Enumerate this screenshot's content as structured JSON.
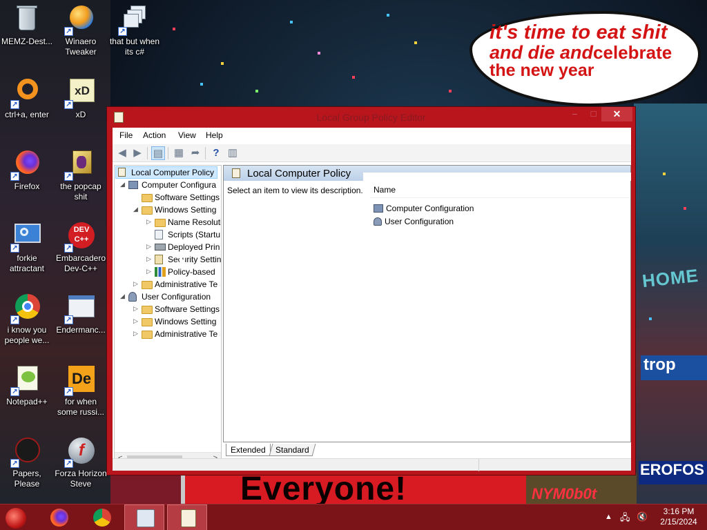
{
  "wallpaper": {
    "bubble_line1": "it's time to eat shit",
    "bubble_line2a": "and die and",
    "bubble_line2b": "celebrate",
    "bubble_line3": "the new year",
    "banner_text": "Everyone!",
    "banner_small": "NYM0b0t",
    "sign_home": "HOME",
    "sign_trop": "trop",
    "sign_erof": "EROFOS",
    "accent_red": "#d81a22"
  },
  "desktop_icons": [
    {
      "label": "MEMZ-Dest...",
      "icon": "recycle-bin-icon"
    },
    {
      "label": "Winaero Tweaker",
      "icon": "winaero-icon"
    },
    {
      "label": "that but when its c#",
      "icon": "windows-stack-icon"
    },
    {
      "label": "ctrl+a, enter",
      "icon": "orange-ring-icon"
    },
    {
      "label": "xD",
      "icon": "xd-icon"
    },
    {
      "label": "Firefox",
      "icon": "firefox-icon"
    },
    {
      "label": "the popcap shit",
      "icon": "popcap-icon"
    },
    {
      "label": "forkie attractant",
      "icon": "control-panel-icon"
    },
    {
      "label": "Embarcadero Dev-C++",
      "icon": "devcpp-icon"
    },
    {
      "label": "i know you people we...",
      "icon": "chrome-icon"
    },
    {
      "label": "Endermanc...",
      "icon": "window-icon"
    },
    {
      "label": "Notepad++",
      "icon": "notepadpp-icon"
    },
    {
      "label": "for when some russi...",
      "icon": "de-icon"
    },
    {
      "label": "Papers, Please",
      "icon": "papers-please-icon"
    },
    {
      "label": "Forza Horizon Steve",
      "icon": "flash-icon"
    }
  ],
  "window": {
    "title": "Local Group Policy Editor",
    "min": "–",
    "max": "□",
    "close": "✕",
    "menu": [
      "File",
      "Action",
      "View",
      "Help"
    ],
    "tree": [
      {
        "label": "Local Computer Policy",
        "expander": "",
        "icon": "policy-icon"
      },
      {
        "label": "Computer Configura",
        "expander": "◢",
        "icon": "computer-icon"
      },
      {
        "label": "Software Settings",
        "expander": "",
        "icon": "folder-icon"
      },
      {
        "label": "Windows Setting",
        "expander": "◢",
        "icon": "folder-icon"
      },
      {
        "label": "Name Resoluti",
        "expander": "▷",
        "icon": "folder-icon"
      },
      {
        "label": "Scripts (Startu",
        "expander": "",
        "icon": "script-icon"
      },
      {
        "label": "Deployed Prin",
        "expander": "▷",
        "icon": "printer-icon"
      },
      {
        "label": "Security Settin",
        "expander": "▷",
        "icon": "security-icon"
      },
      {
        "label": "Policy-based",
        "expander": "▷",
        "icon": "chart-icon"
      },
      {
        "label": "Administrative Te",
        "expander": "▷",
        "icon": "folder-icon"
      },
      {
        "label": "User Configuration",
        "expander": "◢",
        "icon": "user-icon"
      },
      {
        "label": "Software Settings",
        "expander": "▷",
        "icon": "folder-icon"
      },
      {
        "label": "Windows Setting",
        "expander": "▷",
        "icon": "folder-icon"
      },
      {
        "label": "Administrative Te",
        "expander": "▷",
        "icon": "folder-icon"
      }
    ],
    "detail_title": "Local Computer Policy",
    "description": "Select an item to view its description.",
    "column_name": "Name",
    "items": [
      "Computer Configuration",
      "User Configuration"
    ],
    "tabs": [
      "Extended",
      "Standard"
    ]
  },
  "taskbar": {
    "time": "3:16 PM",
    "date": "2/15/2024",
    "tray_arrow": "▲",
    "apps": [
      "firefox-icon",
      "chrome-icon",
      "control-panel-icon",
      "gpedit-icon"
    ]
  }
}
